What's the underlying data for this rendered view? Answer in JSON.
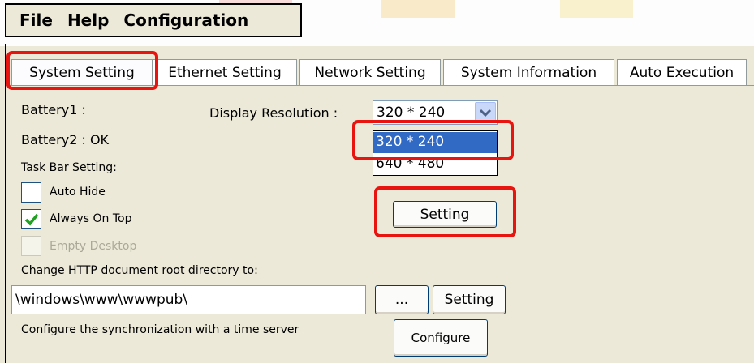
{
  "menu": {
    "file": "File",
    "help": "Help",
    "configuration": "Configuration"
  },
  "tabs": [
    {
      "label": "System Setting",
      "active": true
    },
    {
      "label": "Ethernet Setting"
    },
    {
      "label": "Network Setting"
    },
    {
      "label": "System Information"
    },
    {
      "label": "Auto Execution"
    }
  ],
  "system": {
    "battery1": "Battery1 :",
    "battery2": "Battery2 : OK",
    "display_label": "Display Resolution :",
    "resolution_value": "320 * 240",
    "resolution_options": [
      "320 * 240",
      "640 * 480"
    ],
    "setting_button": "Setting",
    "taskbar_label": "Task Bar Setting:",
    "auto_hide": {
      "label": "Auto Hide",
      "checked": false
    },
    "always_on_top": {
      "label": "Always On Top",
      "checked": true
    },
    "empty_desktop": {
      "label": "Empty Desktop",
      "checked": false,
      "disabled": true
    },
    "http_label": "Change HTTP document root directory to:",
    "http_path": "\\windows\\www\\wwwpub\\",
    "browse_button": "...",
    "http_setting_button": "Setting",
    "sync_label": "Configure the synchronization with a time server",
    "configure_button": "Configure"
  },
  "colors": {
    "highlight": "#e8140f",
    "selection": "#316ac5",
    "panel": "#ece9d8"
  }
}
